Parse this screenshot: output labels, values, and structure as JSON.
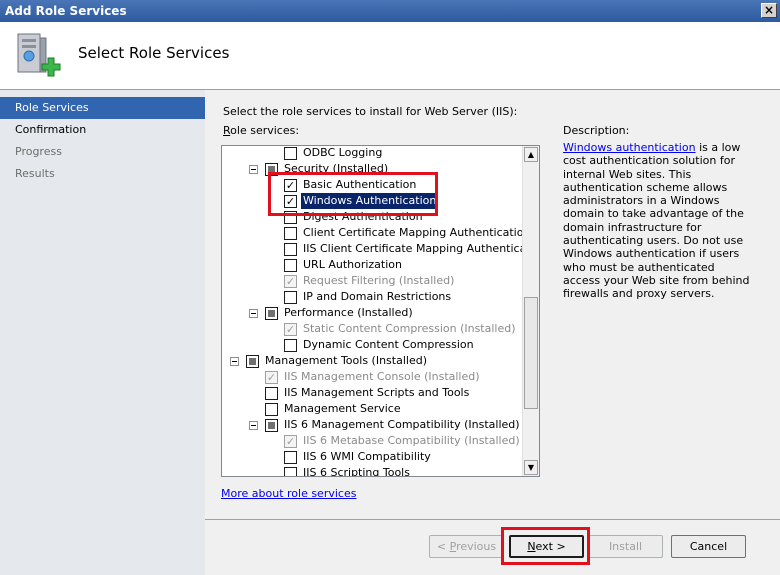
{
  "window": {
    "title": "Add Role Services",
    "close_glyph": "×"
  },
  "header": {
    "title": "Select Role Services",
    "icon": "server-add-icon"
  },
  "nav": {
    "items": [
      {
        "label": "Role Services",
        "state": "active"
      },
      {
        "label": "Confirmation",
        "state": "normal"
      },
      {
        "label": "Progress",
        "state": "disabled"
      },
      {
        "label": "Results",
        "state": "disabled"
      }
    ]
  },
  "main": {
    "instruction": "Select the role services to install for Web Server (IIS):",
    "role_services_label_accel": "R",
    "role_services_label_rest": "ole services:",
    "description_label": "Description:",
    "description_link": "Windows authentication",
    "description_body": " is a low cost authentication solution for internal Web sites. This authentication scheme allows administrators in a Windows domain to take advantage of the domain infrastructure for authenticating users. Do not use Windows authentication if users who must be authenticated access your Web site from behind firewalls and proxy servers.",
    "more_link": "More about role services"
  },
  "tree": {
    "items": [
      {
        "label": "ODBC Logging",
        "checked": false
      },
      {
        "label": "Security  (Installed)",
        "expander": true,
        "partial": true
      },
      {
        "label": "Basic Authentication",
        "checked": true
      },
      {
        "label": "Windows Authentication",
        "checked": true,
        "selected": true
      },
      {
        "label": "Digest Authentication",
        "checked": false
      },
      {
        "label": "Client Certificate Mapping Authentication",
        "checked": false
      },
      {
        "label": "IIS Client Certificate Mapping Authentication",
        "checked": false
      },
      {
        "label": "URL Authorization",
        "checked": false
      },
      {
        "label": "Request Filtering  (Installed)",
        "checked": true,
        "disabled": true
      },
      {
        "label": "IP and Domain Restrictions",
        "checked": false
      },
      {
        "label": "Performance  (Installed)",
        "expander": true,
        "partial": true
      },
      {
        "label": "Static Content Compression  (Installed)",
        "checked": true,
        "disabled": true
      },
      {
        "label": "Dynamic Content Compression",
        "checked": false
      },
      {
        "label": "Management Tools  (Installed)",
        "expander": true,
        "partial": true
      },
      {
        "label": "IIS Management Console  (Installed)",
        "checked": true,
        "disabled": true
      },
      {
        "label": "IIS Management Scripts and Tools",
        "checked": false
      },
      {
        "label": "Management Service",
        "checked": false
      },
      {
        "label": "IIS 6 Management Compatibility  (Installed)",
        "expander": true,
        "partial": true
      },
      {
        "label": "IIS 6 Metabase Compatibility  (Installed)",
        "checked": true,
        "disabled": true
      },
      {
        "label": "IIS 6 WMI Compatibility",
        "checked": false
      },
      {
        "label": "IIS 6 Scripting Tools",
        "checked": false
      }
    ]
  },
  "buttons": {
    "previous_accel": "P",
    "previous_rest": "revious",
    "previous_prefix": "< ",
    "next_accel": "N",
    "next_rest": "ext >",
    "install": "Install",
    "cancel": "Cancel"
  },
  "colors": {
    "highlight_box": "#e0101f",
    "nav_active": "#3165b0"
  }
}
